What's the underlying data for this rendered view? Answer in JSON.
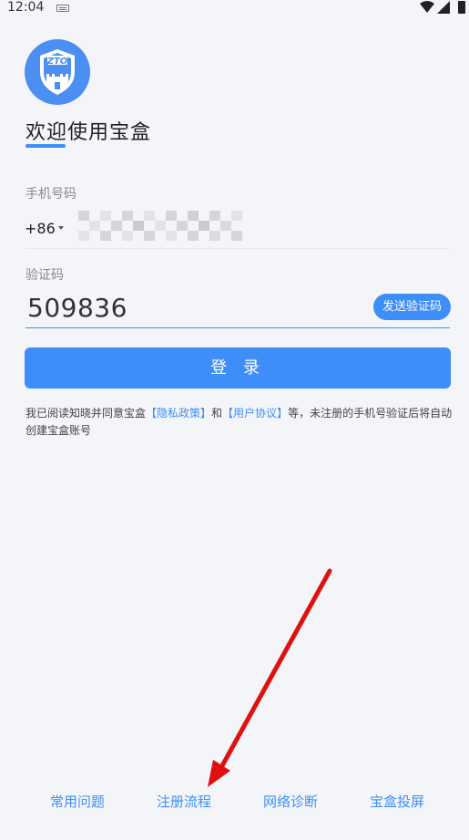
{
  "status_bar": {
    "time": "12:04",
    "icons": [
      "keyboard-icon",
      "wifi-icon",
      "signal-icon",
      "battery-icon"
    ]
  },
  "logo": {
    "text": "ZTO",
    "icon": "castle-shield-icon",
    "color": "#4b8ff2"
  },
  "welcome": {
    "title": "欢迎使用宝盒"
  },
  "phone": {
    "label": "手机号码",
    "country_code": "+86",
    "value_masked": true
  },
  "verification": {
    "label": "验证码",
    "value": "509836",
    "send_button": "发送验证码"
  },
  "login_button": "登 录",
  "agreement": {
    "prefix": "我已阅读知晓并同意宝盒",
    "privacy_link": "【隐私政策】",
    "and": "和",
    "user_link": "【用户协议】",
    "suffix": "等，未注册的手机号验证后将自动创建宝盒账号"
  },
  "bottom_links": {
    "faq": "常用问题",
    "register_flow": "注册流程",
    "network": "网络诊断",
    "cast": "宝盒投屏"
  },
  "colors": {
    "accent": "#3d8ef8",
    "background": "#f3f5f8",
    "annotation_arrow": "#e01010"
  }
}
